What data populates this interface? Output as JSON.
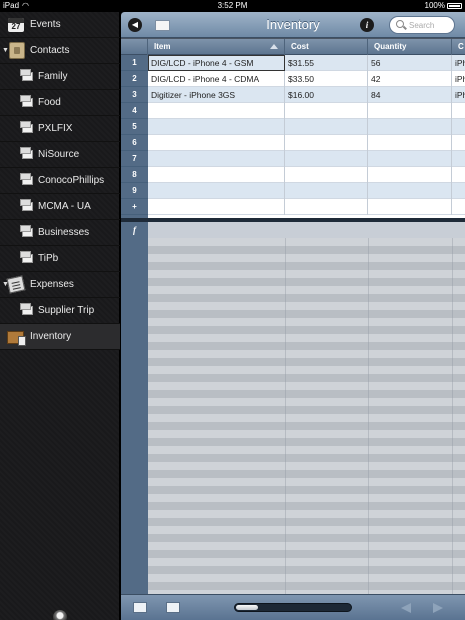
{
  "status_bar": {
    "carrier": "iPad",
    "time": "3:52 PM",
    "battery": "100%"
  },
  "sidebar": {
    "items": [
      {
        "label": "Events",
        "icon": "calendar-icon",
        "calendar_day": "27"
      },
      {
        "label": "Contacts",
        "icon": "address-book-icon",
        "expanded": true
      },
      {
        "label": "Family",
        "icon": "folder-icon"
      },
      {
        "label": "Food",
        "icon": "folder-icon"
      },
      {
        "label": "PXLFIX",
        "icon": "folder-icon"
      },
      {
        "label": "NiSource",
        "icon": "folder-icon"
      },
      {
        "label": "ConocoPhillips",
        "icon": "folder-icon"
      },
      {
        "label": "MCMA - UA",
        "icon": "folder-icon"
      },
      {
        "label": "Businesses",
        "icon": "folder-icon"
      },
      {
        "label": "TiPb",
        "icon": "folder-icon"
      },
      {
        "label": "Expenses",
        "icon": "receipt-icon",
        "expanded": true
      },
      {
        "label": "Supplier Trip",
        "icon": "folder-icon"
      },
      {
        "label": "Inventory",
        "icon": "box-icon",
        "selected": true
      }
    ]
  },
  "topbar": {
    "title": "Inventory",
    "search_placeholder": "Search"
  },
  "table": {
    "columns": [
      "Item",
      "Cost",
      "Quantity",
      "C"
    ],
    "row_numbers": [
      "1",
      "2",
      "3",
      "4",
      "5",
      "6",
      "7",
      "8",
      "9",
      "+"
    ],
    "rows": [
      [
        "DIG/LCD - iPhone 4 - GSM",
        "$31.55",
        "56",
        "iPh"
      ],
      [
        "DIG/LCD - iPhone 4 - CDMA",
        "$33.50",
        "42",
        "iPh"
      ],
      [
        "Digitizer - iPhone 3GS",
        "$16.00",
        "84",
        "iPh"
      ]
    ],
    "formula_symbol": "f"
  },
  "colors": {
    "accent": "#6f8aa6",
    "row_highlight": "#dbe6f1",
    "sidebar_bg": "#1d1d1f"
  }
}
